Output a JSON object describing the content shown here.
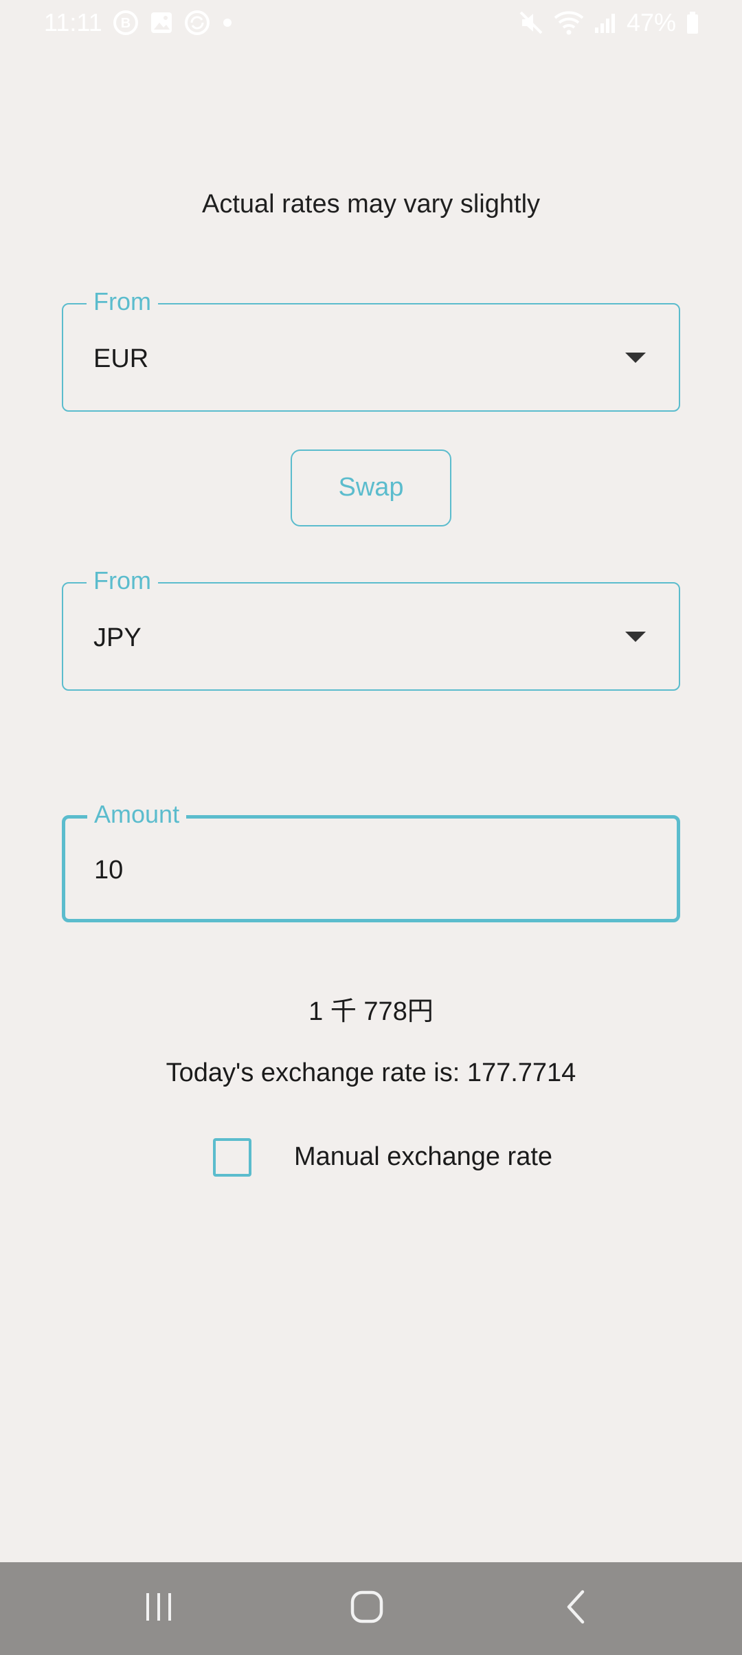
{
  "status_bar": {
    "time": "11:11",
    "battery": "47%"
  },
  "converter": {
    "notice": "Actual rates may vary slightly",
    "from_field": {
      "legend": "From",
      "value": "EUR"
    },
    "swap_label": "Swap",
    "to_field": {
      "legend": "From",
      "value": "JPY"
    },
    "amount_field": {
      "legend": "Amount",
      "value": "10"
    },
    "result": "1 千 778円",
    "rate_text": "Today's exchange rate is: 177.7714",
    "manual_rate": {
      "label": "Manual exchange rate",
      "checked": false
    }
  },
  "colors": {
    "accent": "#5bbccd",
    "background": "#f2efed",
    "nav_bar": "#908e8c"
  },
  "icons": {
    "status_left": [
      "b-circle-icon",
      "image-icon",
      "sync-circle-icon",
      "dot-icon"
    ],
    "status_right": [
      "mute-icon",
      "wifi-icon",
      "signal-icon",
      "battery-icon"
    ],
    "nav": [
      "recents-icon",
      "home-icon",
      "back-icon"
    ]
  }
}
